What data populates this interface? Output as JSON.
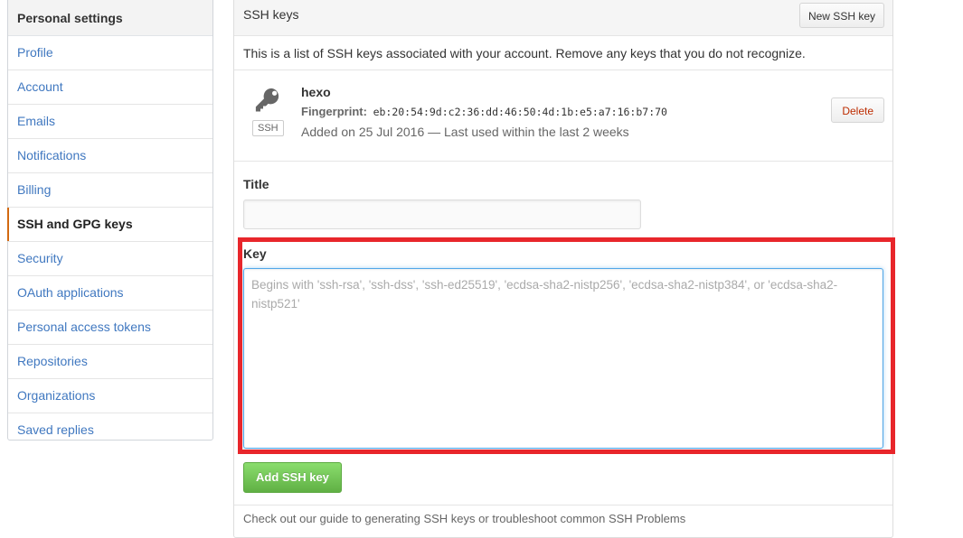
{
  "sidebar": {
    "header": "Personal settings",
    "items": [
      {
        "label": "Profile"
      },
      {
        "label": "Account"
      },
      {
        "label": "Emails"
      },
      {
        "label": "Notifications"
      },
      {
        "label": "Billing"
      },
      {
        "label": "SSH and GPG keys",
        "selected": true
      },
      {
        "label": "Security"
      },
      {
        "label": "OAuth applications"
      },
      {
        "label": "Personal access tokens"
      },
      {
        "label": "Repositories"
      },
      {
        "label": "Organizations"
      },
      {
        "label": "Saved replies"
      }
    ]
  },
  "panel": {
    "title": "SSH keys",
    "new_key_button": "New SSH key",
    "description": "This is a list of SSH keys associated with your account. Remove any keys that you do not recognize."
  },
  "key": {
    "icon": "key-icon",
    "badge": "SSH",
    "name": "hexo",
    "fingerprint_label": "Fingerprint:",
    "fingerprint": "eb:20:54:9d:c2:36:dd:46:50:4d:1b:e5:a7:16:b7:70",
    "added": "Added on 25 Jul 2016 — Last used within the last 2 weeks",
    "delete_button": "Delete"
  },
  "form": {
    "title_label": "Title",
    "title_value": "",
    "key_label": "Key",
    "key_placeholder": "Begins with 'ssh-rsa', 'ssh-dss', 'ssh-ed25519', 'ecdsa-sha2-nistp256', 'ecdsa-sha2-nistp384', or 'ecdsa-sha2-nistp521'",
    "submit_button": "Add SSH key"
  },
  "footer": {
    "hint_prefix": "Check out our guide to generating SSH keys or troubleshoot common SSH Problems"
  },
  "colors": {
    "link": "#4078c0",
    "highlight": "#e8262b",
    "primary_button": "#60b044",
    "danger_text": "#bd2c00",
    "selected_indicator": "#d26911"
  }
}
